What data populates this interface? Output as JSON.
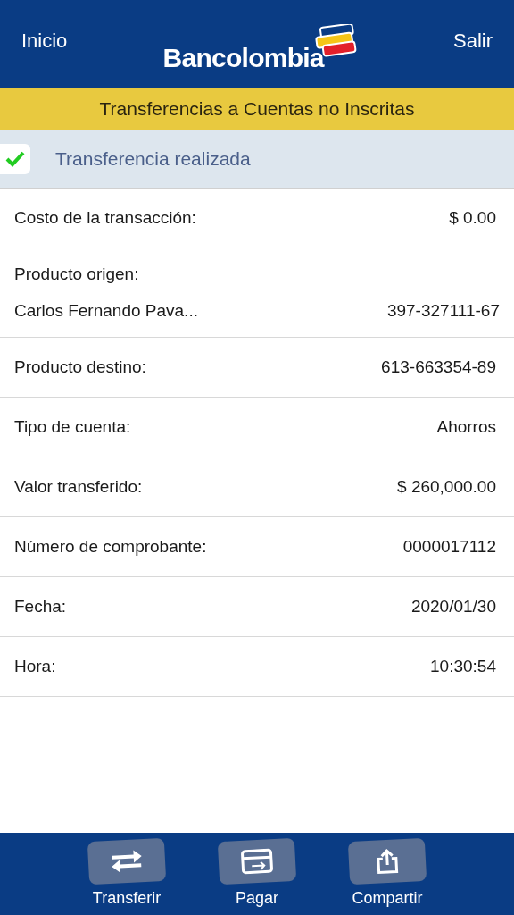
{
  "header": {
    "left": "Inicio",
    "logo": "Bancolombia",
    "right": "Salir"
  },
  "title": "Transferencias a Cuentas no Inscritas",
  "status": {
    "text": "Transferencia realizada",
    "success": true
  },
  "rows": [
    {
      "kind": "pair",
      "label": "Costo de la transacción:",
      "value": "$ 0.00"
    },
    {
      "kind": "stacked",
      "label": "Producto origen:",
      "name": "Carlos Fernando Pava...",
      "value": "397-327111-67"
    },
    {
      "kind": "pair",
      "label": "Producto destino:",
      "value": "613-663354-89"
    },
    {
      "kind": "pair",
      "label": "Tipo de cuenta:",
      "value": "Ahorros"
    },
    {
      "kind": "pair",
      "label": "Valor transferido:",
      "value": "$ 260,000.00"
    },
    {
      "kind": "pair",
      "label": "Número de comprobante:",
      "value": "0000017112"
    },
    {
      "kind": "pair",
      "label": "Fecha:",
      "value": "2020/01/30"
    },
    {
      "kind": "pair",
      "label": "Hora:",
      "value": "10:30:54"
    }
  ],
  "actions": [
    {
      "kind": "transfer",
      "label": "Transferir"
    },
    {
      "kind": "pay",
      "label": "Pagar"
    },
    {
      "kind": "share",
      "label": "Compartir"
    }
  ]
}
